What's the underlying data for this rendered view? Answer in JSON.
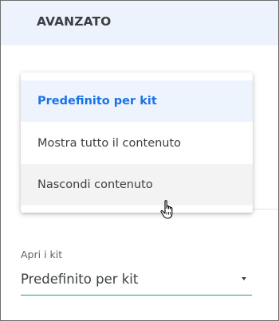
{
  "section": {
    "title": "AVANZATO"
  },
  "menu": {
    "items": [
      {
        "label": "Predefinito per kit",
        "state": "selected"
      },
      {
        "label": "Mostra tutto il contenuto",
        "state": "normal"
      },
      {
        "label": "Nascondi contenuto",
        "state": "hovered"
      }
    ]
  },
  "field": {
    "label": "Apri i kit",
    "value": "Predefinito per kit"
  },
  "icons": {
    "dropdown_arrow": "caret-down-icon",
    "cursor": "hand-pointer-cursor"
  },
  "colors": {
    "accent": "#1a73e8",
    "header_bg": "#edf3fc",
    "underline": "#1a9a8f"
  }
}
